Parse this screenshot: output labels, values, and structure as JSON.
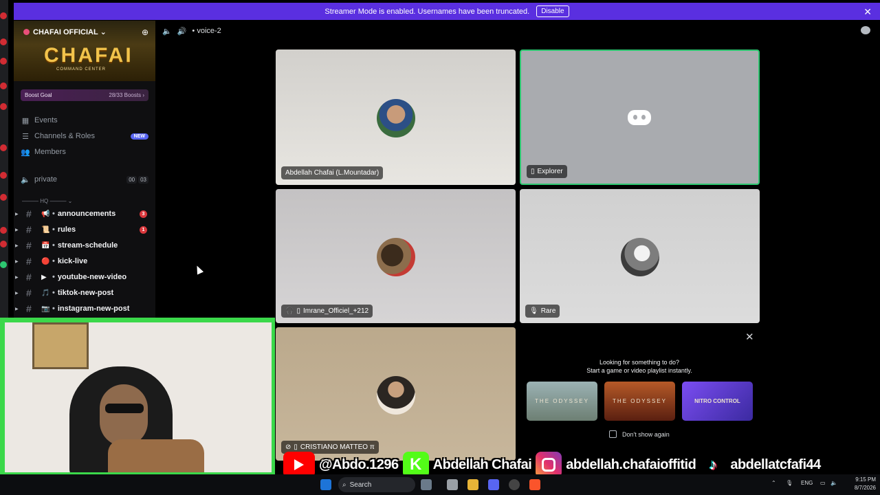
{
  "banner": {
    "text": "Streamer Mode is enabled. Usernames have been truncated.",
    "button": "Disable",
    "close": "✕"
  },
  "server": {
    "name": "CHAFAI OFFICIAL",
    "logo_text": "CHAFAI",
    "logo_sub": "COMMAND CENTER",
    "boost": {
      "label": "Boost Goal",
      "progress": "28/33 Boosts",
      "fraction": 0.85
    }
  },
  "menu": {
    "events": "Events",
    "channels_roles": "Channels & Roles",
    "new_badge": "NEW",
    "members": "Members"
  },
  "private_channel": {
    "name": "private",
    "count_a": "00",
    "count_b": "03"
  },
  "category": "HQ",
  "channels": [
    {
      "name": "announcements",
      "emoji": "📢",
      "badge": "3"
    },
    {
      "name": "rules",
      "emoji": "📜",
      "badge": "1"
    },
    {
      "name": "stream-schedule",
      "emoji": "📅",
      "badge": ""
    },
    {
      "name": "kick-live",
      "emoji": "🔴",
      "badge": ""
    },
    {
      "name": "youtube-new-video",
      "emoji": "▶",
      "badge": ""
    },
    {
      "name": "tiktok-new-post",
      "emoji": "🎵",
      "badge": ""
    },
    {
      "name": "instagram-new-post",
      "emoji": "📷",
      "badge": ""
    }
  ],
  "voice": {
    "channel": "voice-2"
  },
  "tiles": [
    {
      "label": "Abdellah Chafai (L.Mountadar)"
    },
    {
      "label": "Explorer"
    },
    {
      "label": "Imrane_Officiel_+212"
    },
    {
      "label": "Rare"
    },
    {
      "label": "CRISTIANO MATTEO π"
    }
  ],
  "activity_prompt": {
    "line1": "Looking for something to do?",
    "line2": "Start a game or video playlist instantly.",
    "games": [
      "THE ODYSSEY",
      "THE ODYSSEY",
      "NITRO CONTROL"
    ],
    "dont_show": "Don't show again"
  },
  "overlay": {
    "youtube": "@Abdo.1296",
    "kick": "Abdellah Chafai",
    "instagram": "abdellah.chafaioffitid",
    "tiktok": "abdellatcfafi44"
  },
  "taskbar": {
    "search": "Search",
    "lang": "ENG",
    "time": "9:15 PM",
    "date": "8/7/2026"
  },
  "colors": {
    "banner": "#5a2fe0",
    "accent": "#5865f2",
    "camera_border": "#3bd84a",
    "badge": "#da373c",
    "speaking": "#2dc770"
  }
}
